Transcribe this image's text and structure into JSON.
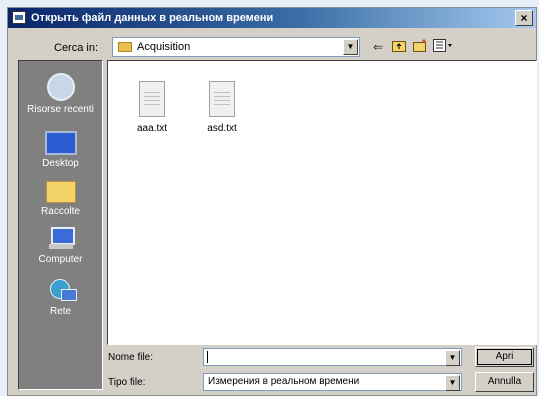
{
  "dialog": {
    "title": "Открыть файл данных в реальном времени",
    "close": "×"
  },
  "lookin": {
    "label": "Cerca in:",
    "value": "Acquisition",
    "toolbar": [
      "back-icon",
      "up-folder-icon",
      "new-folder-icon",
      "view-menu-icon"
    ]
  },
  "places": [
    {
      "label": "Risorse recenti",
      "icon": "recent-icon"
    },
    {
      "label": "Desktop",
      "icon": "desktop-icon"
    },
    {
      "label": "Raccolte",
      "icon": "libraries-icon"
    },
    {
      "label": "Computer",
      "icon": "computer-icon"
    },
    {
      "label": "Rete",
      "icon": "network-icon"
    }
  ],
  "files": [
    {
      "name": "aaa.txt"
    },
    {
      "name": "asd.txt"
    }
  ],
  "filename": {
    "label": "Nome file:",
    "value": ""
  },
  "filetype": {
    "label": "Tipo file:",
    "value": "Измерения в реальном времени"
  },
  "buttons": {
    "open": "Apri",
    "cancel": "Annulla"
  },
  "colors": {
    "title_gradient_start": "#0a246a",
    "title_gradient_end": "#a6caf0",
    "places_bar": "#808080",
    "window_face": "#d4d0c8"
  }
}
